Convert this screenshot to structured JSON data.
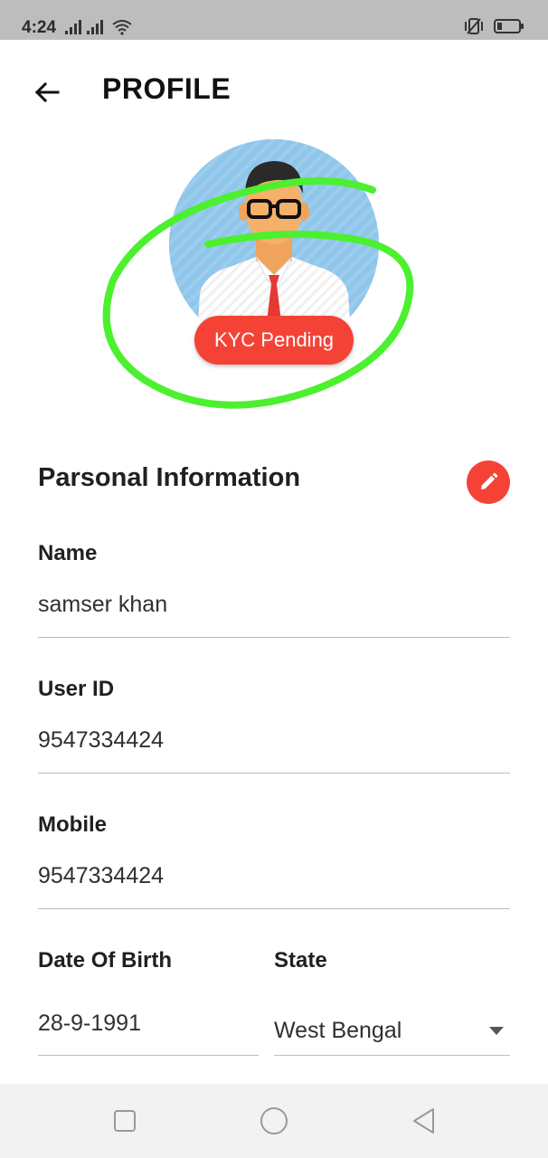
{
  "status_bar": {
    "time": "4:24",
    "signal_icon": "signal-bars-icon",
    "wifi_icon": "wifi-icon",
    "vibrate_icon": "vibrate-icon",
    "battery_icon": "battery-icon"
  },
  "header": {
    "back_icon": "arrow-left-icon",
    "title": "PROFILE"
  },
  "profile": {
    "avatar_icon": "man-avatar-illustration",
    "kyc_status": "KYC Pending"
  },
  "personal_info": {
    "section_title": "Parsonal Information",
    "edit_icon": "pencil-icon",
    "fields": {
      "name": {
        "label": "Name",
        "value": "samser khan"
      },
      "user_id": {
        "label": "User ID",
        "value": "9547334424"
      },
      "mobile": {
        "label": "Mobile",
        "value": "9547334424"
      },
      "dob": {
        "label": "Date Of Birth",
        "value": "28-9-1991"
      },
      "state": {
        "label": "State",
        "value": "West Bengal"
      }
    }
  },
  "nav_bar": {
    "recents_icon": "square-icon",
    "home_icon": "circle-icon",
    "back_icon": "triangle-back-icon"
  },
  "colors": {
    "accent": "#f44336",
    "highlight_scribble": "#4cf02f",
    "avatar_bg": "#8fc6ea",
    "status_bar": "#bdbdbd"
  }
}
